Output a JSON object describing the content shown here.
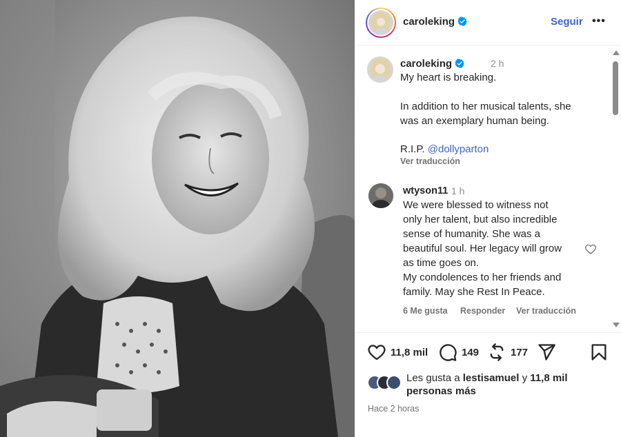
{
  "header": {
    "username": "caroleking",
    "follow_label": "Seguir",
    "more_label": "•••"
  },
  "caption": {
    "username": "caroleking",
    "time": "2 h",
    "lines": [
      "My heart is breaking.",
      "In addition to her musical talents, she",
      "was an exemplary human being."
    ],
    "rip_prefix": "R.I.P. ",
    "mention": "@dollyparton",
    "translate_label": "Ver traducción"
  },
  "comment": {
    "username": "wtyson11",
    "time": "1 h",
    "lines": [
      "We were blessed to witness not",
      "only her talent, but also incredible",
      "sense of humanity. She was a",
      "beautiful soul. Her legacy will grow",
      "as time goes on.",
      "My condolences to her friends and",
      "family. May she Rest In Peace."
    ],
    "likes_label": "6 Me gusta",
    "reply_label": "Responder",
    "translate_label": "Ver traducción"
  },
  "actions": {
    "likes_count": "11,8 mil",
    "comments_count": "149",
    "reposts_count": "177"
  },
  "liked_by": {
    "prefix": "Les gusta a ",
    "user": "lestisamuel",
    "middle": " y ",
    "count": "11,8 mil",
    "line2": "personas más"
  },
  "timestamp": "Hace 2 horas",
  "colors": {
    "link": "#3f64c9",
    "verified": "#0095f6",
    "secondary_text": "#737373"
  }
}
